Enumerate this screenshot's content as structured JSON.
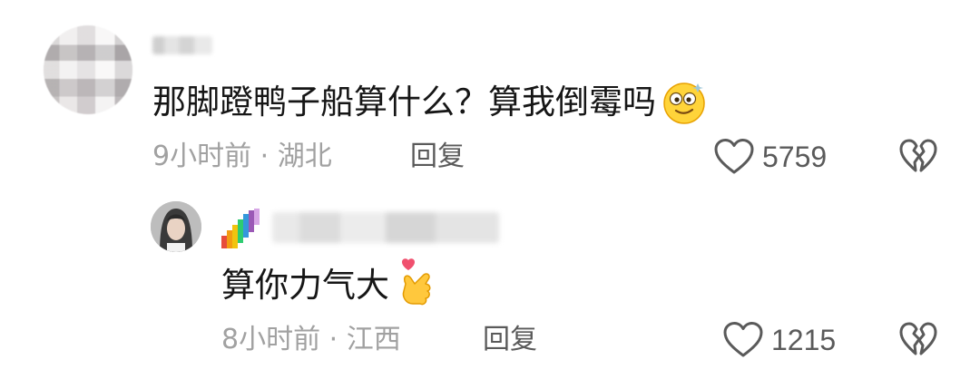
{
  "comments": [
    {
      "content": "那脚蹬鸭子船算什么？算我倒霉吗",
      "content_emoji": "dizzy-face-emoji",
      "time": "9小时前",
      "separator": "·",
      "location": "湖北",
      "reply_label": "回复",
      "like_count": "5759"
    },
    {
      "content": "算你力气大",
      "content_emoji": "finger-heart-emoji",
      "time": "8小时前",
      "separator": "·",
      "location": "江西",
      "reply_label": "回复",
      "like_count": "1215"
    }
  ],
  "icons": {
    "like": "heart-outline-icon",
    "dislike": "broken-heart-icon"
  },
  "colors": {
    "text_primary": "#161616",
    "text_meta": "#a1a1a1",
    "text_action": "#5a5a5a"
  }
}
